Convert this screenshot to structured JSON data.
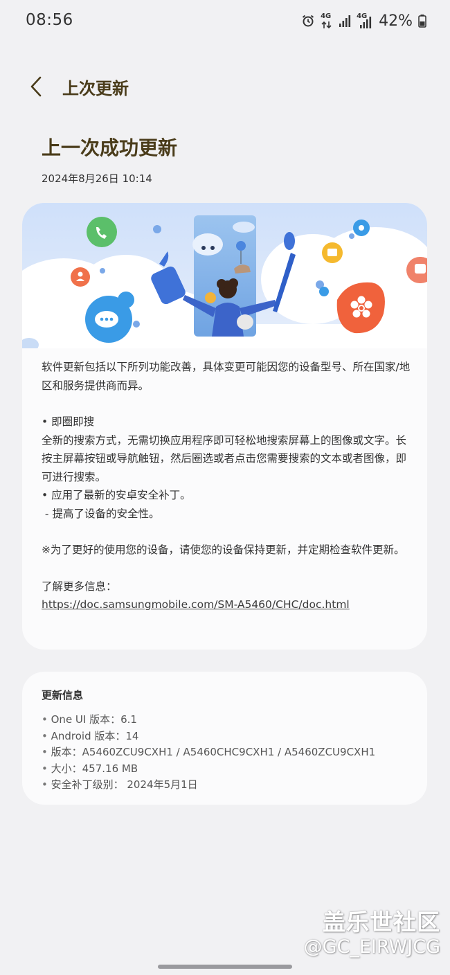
{
  "status_bar": {
    "time": "08:56",
    "signal1_label": "4G",
    "signal2_label": "4G",
    "battery_percent": "42%",
    "icons": [
      "alarm-icon",
      "data-4g-icon",
      "signal-icon",
      "signal-4g-icon",
      "battery-icon"
    ]
  },
  "header": {
    "back_icon": "chevron-left-icon",
    "title": "上次更新"
  },
  "main": {
    "title": "上一次成功更新",
    "date": "2024年8月26日 10:14"
  },
  "notes": {
    "intro": "软件更新包括以下所列功能改善，具体变更可能因您的设备型号、所在国家/地区和服务提供商而异。",
    "feature_title": "• 即圈即搜",
    "feature_desc": "全新的搜索方式，无需切换应用程序即可轻松地搜索屏幕上的图像或文字。长按主屏幕按钮或导航触钮，然后圈选或者点击您需要搜索的文本或者图像，即可进行搜索。",
    "security_line": "• 应用了最新的安卓安全补丁。",
    "security_sub": " - 提高了设备的安全性。",
    "reminder": "※为了更好的使用您的设备，请使您的设备保持更新，并定期检查软件更新。",
    "more_info_label": "了解更多信息：",
    "link": "https://doc.samsungmobile.com/SM-A5460/CHC/doc.html"
  },
  "update_info": {
    "heading": "更新信息",
    "items": [
      "One UI 版本：6.1",
      "Android 版本：14",
      "版本：A5460ZCU9CXH1 / A5460CHC9CXH1 / A5460ZCU9CXH1",
      "大小：457.16 MB",
      "安全补丁级别： 2024年5月1日"
    ]
  },
  "watermark": {
    "line1": "盖乐世社区",
    "line2": "@GC_EIRWJCG"
  },
  "colors": {
    "background": "#f1f1f3",
    "card": "#fbfbfc",
    "title_brown": "#4a3c1a",
    "phone_green": "#5bbf6a",
    "chat_blue": "#3a9be6",
    "flower_orange": "#f0623c",
    "folder_yellow": "#f5b92e"
  }
}
